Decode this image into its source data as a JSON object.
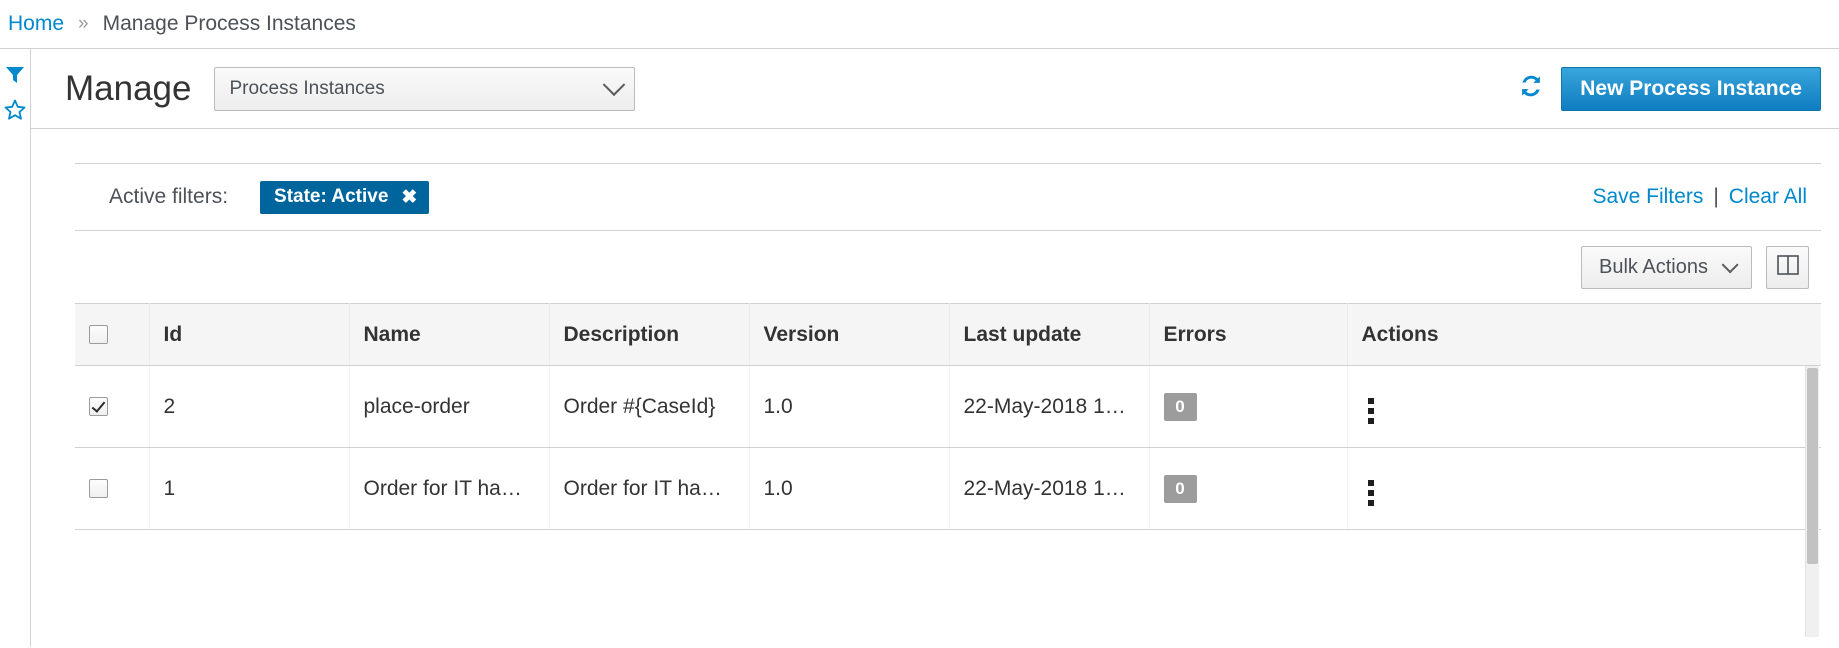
{
  "breadcrumb": {
    "home_label": "Home",
    "separator": "»",
    "current_label": "Manage Process Instances"
  },
  "rail": {
    "filter_icon": "filter-funnel-icon",
    "star_icon": "star-outline-icon"
  },
  "header": {
    "title": "Manage",
    "entity_select_value": "Process Instances",
    "entity_select_icon": "chevron-down-icon",
    "refresh_icon": "refresh-icon",
    "new_instance_label": "New Process Instance"
  },
  "filters": {
    "label": "Active filters:",
    "chips": [
      {
        "label": "State: Active",
        "remove_icon": "close-icon"
      }
    ],
    "save_label": "Save Filters",
    "separator": "|",
    "clear_label": "Clear All"
  },
  "toolbar": {
    "bulk_actions_label": "Bulk Actions",
    "bulk_actions_icon": "chevron-down-icon",
    "column_picker_icon": "columns-icon"
  },
  "table": {
    "select_all_checked": false,
    "columns": [
      "Id",
      "Name",
      "Description",
      "Version",
      "Last update",
      "Errors",
      "Actions"
    ],
    "rows": [
      {
        "selected": true,
        "id": "2",
        "name": "place-order",
        "description": "Order #{CaseId}",
        "version": "1.0",
        "last_update": "22-May-2018 1…",
        "errors": "0",
        "actions_icon": "kebab-menu-icon"
      },
      {
        "selected": false,
        "id": "1",
        "name": "Order for IT ha…",
        "description": "Order for IT ha…",
        "version": "1.0",
        "last_update": "22-May-2018 1…",
        "errors": "0",
        "actions_icon": "kebab-menu-icon"
      }
    ]
  },
  "colors": {
    "link": "#0088ce",
    "primary_button": "#0f7dc1",
    "chip": "#00659c",
    "badge": "#9c9c9c"
  }
}
